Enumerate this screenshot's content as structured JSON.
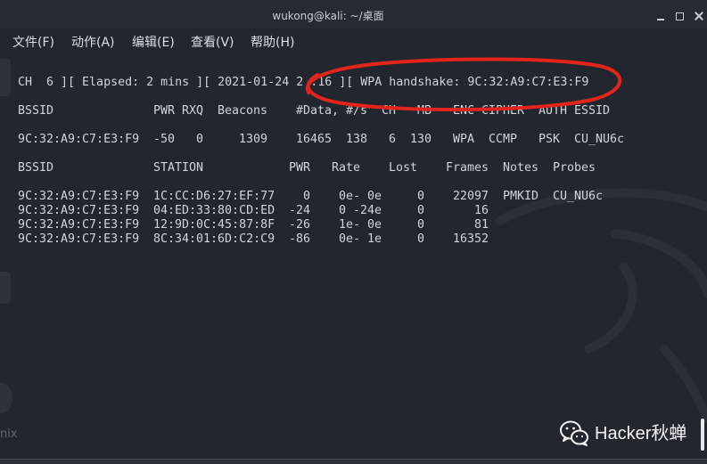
{
  "window": {
    "title": "wukong@kali: ~/桌面",
    "controls": [
      "minimize-icon",
      "maximize-icon",
      "close-icon"
    ]
  },
  "menu": [
    "文件(F)",
    "动作(A)",
    "编辑(E)",
    "查看(V)",
    "帮助(H)"
  ],
  "airodump": {
    "status_line": "CH  6 ][ Elapsed: 2 mins ][ 2021-01-24 2 :16 ][ WPA handshake: 9C:32:A9:C7:E3:F9",
    "ap_table": {
      "headers": [
        "BSSID",
        "PWR",
        "RXQ",
        "Beacons",
        "#Data,",
        "#/s",
        "CH",
        "MB",
        "ENC",
        "CIPHER",
        "AUTH",
        "ESSID"
      ],
      "rows": [
        [
          "9C:32:A9:C7:E3:F9",
          "-50",
          "0",
          "1309",
          "16465",
          "138",
          "6",
          "130",
          "WPA",
          "CCMP",
          "PSK",
          "CU_NU6c"
        ]
      ]
    },
    "station_table": {
      "headers": [
        "BSSID",
        "STATION",
        "PWR",
        "Rate",
        "Lost",
        "Frames",
        "Notes",
        "Probes"
      ],
      "rows": [
        [
          "9C:32:A9:C7:E3:F9",
          "1C:CC:D6:27:EF:77",
          "0",
          "0e- 0e",
          "0",
          "22097",
          "PMKID",
          "CU_NU6c"
        ],
        [
          "9C:32:A9:C7:E3:F9",
          "04:ED:33:80:CD:ED",
          "-24",
          "0 -24e",
          "0",
          "16",
          "",
          ""
        ],
        [
          "9C:32:A9:C7:E3:F9",
          "12:9D:0C:45:87:8F",
          "-26",
          "1e- 0e",
          "0",
          "81",
          "",
          ""
        ],
        [
          "9C:32:A9:C7:E3:F9",
          "8C:34:01:6D:C2:C9",
          "-86",
          "0e- 1e",
          "0",
          "16352",
          "",
          ""
        ]
      ]
    }
  },
  "watermark": {
    "icon": "wechat-icon",
    "text": "Hacker秋蝉"
  },
  "desktop": {
    "partial_label": "nix"
  },
  "colors": {
    "terminal_bg": "#22272f",
    "text": "#d0d3d8",
    "annotation": "#e3241b",
    "watermark_text": "#f4f4f4"
  }
}
